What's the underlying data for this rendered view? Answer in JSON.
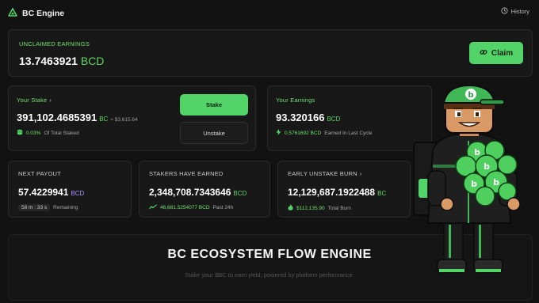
{
  "header": {
    "app_title": "BC Engine",
    "history_label": "History"
  },
  "unclaimed": {
    "label": "UNCLAIMED EARNINGS",
    "amount": "13.7463921",
    "unit": "BCD",
    "claim_label": "Claim"
  },
  "stake": {
    "label": "Your Stake",
    "amount": "391,102.4685391",
    "unit": "BC",
    "usd": "≈ $3,615.64",
    "pct": "0.03%",
    "pct_caption": "Of Total Staked",
    "stake_button": "Stake",
    "unstake_button": "Unstake"
  },
  "earnings": {
    "label": "Your Earnings",
    "amount": "93.320166",
    "unit": "BCD",
    "cycle_value": "0.5761692 BCD",
    "cycle_caption": "Earned In Last Cycle"
  },
  "payout": {
    "label": "NEXT PAYOUT",
    "amount": "57.4229941",
    "unit": "BCD",
    "timer": "58 m : 33 s",
    "timer_caption": "Remaining"
  },
  "stakers": {
    "label": "STAKERS HAVE EARNED",
    "amount": "2,348,708.7343646",
    "unit": "BCD",
    "delta": "46,681.5254077 BCD",
    "delta_caption": "Past 24h"
  },
  "burn": {
    "label": "EARLY UNSTAKE BURN",
    "amount": "12,129,687.1922488",
    "unit": "BC",
    "usd": "$112,135.90",
    "caption": "Total Burn"
  },
  "hero": {
    "title": "BC ECOSYSTEM FLOW ENGINE",
    "subtitle": "Stake your $BC to earn yield, powered by platform performance."
  },
  "mascot": {
    "cap_letter": "b",
    "coin_letter": "b"
  },
  "colors": {
    "accent": "#52d468",
    "purple": "#a58cff",
    "bg": "#121212",
    "card": "#181818"
  }
}
